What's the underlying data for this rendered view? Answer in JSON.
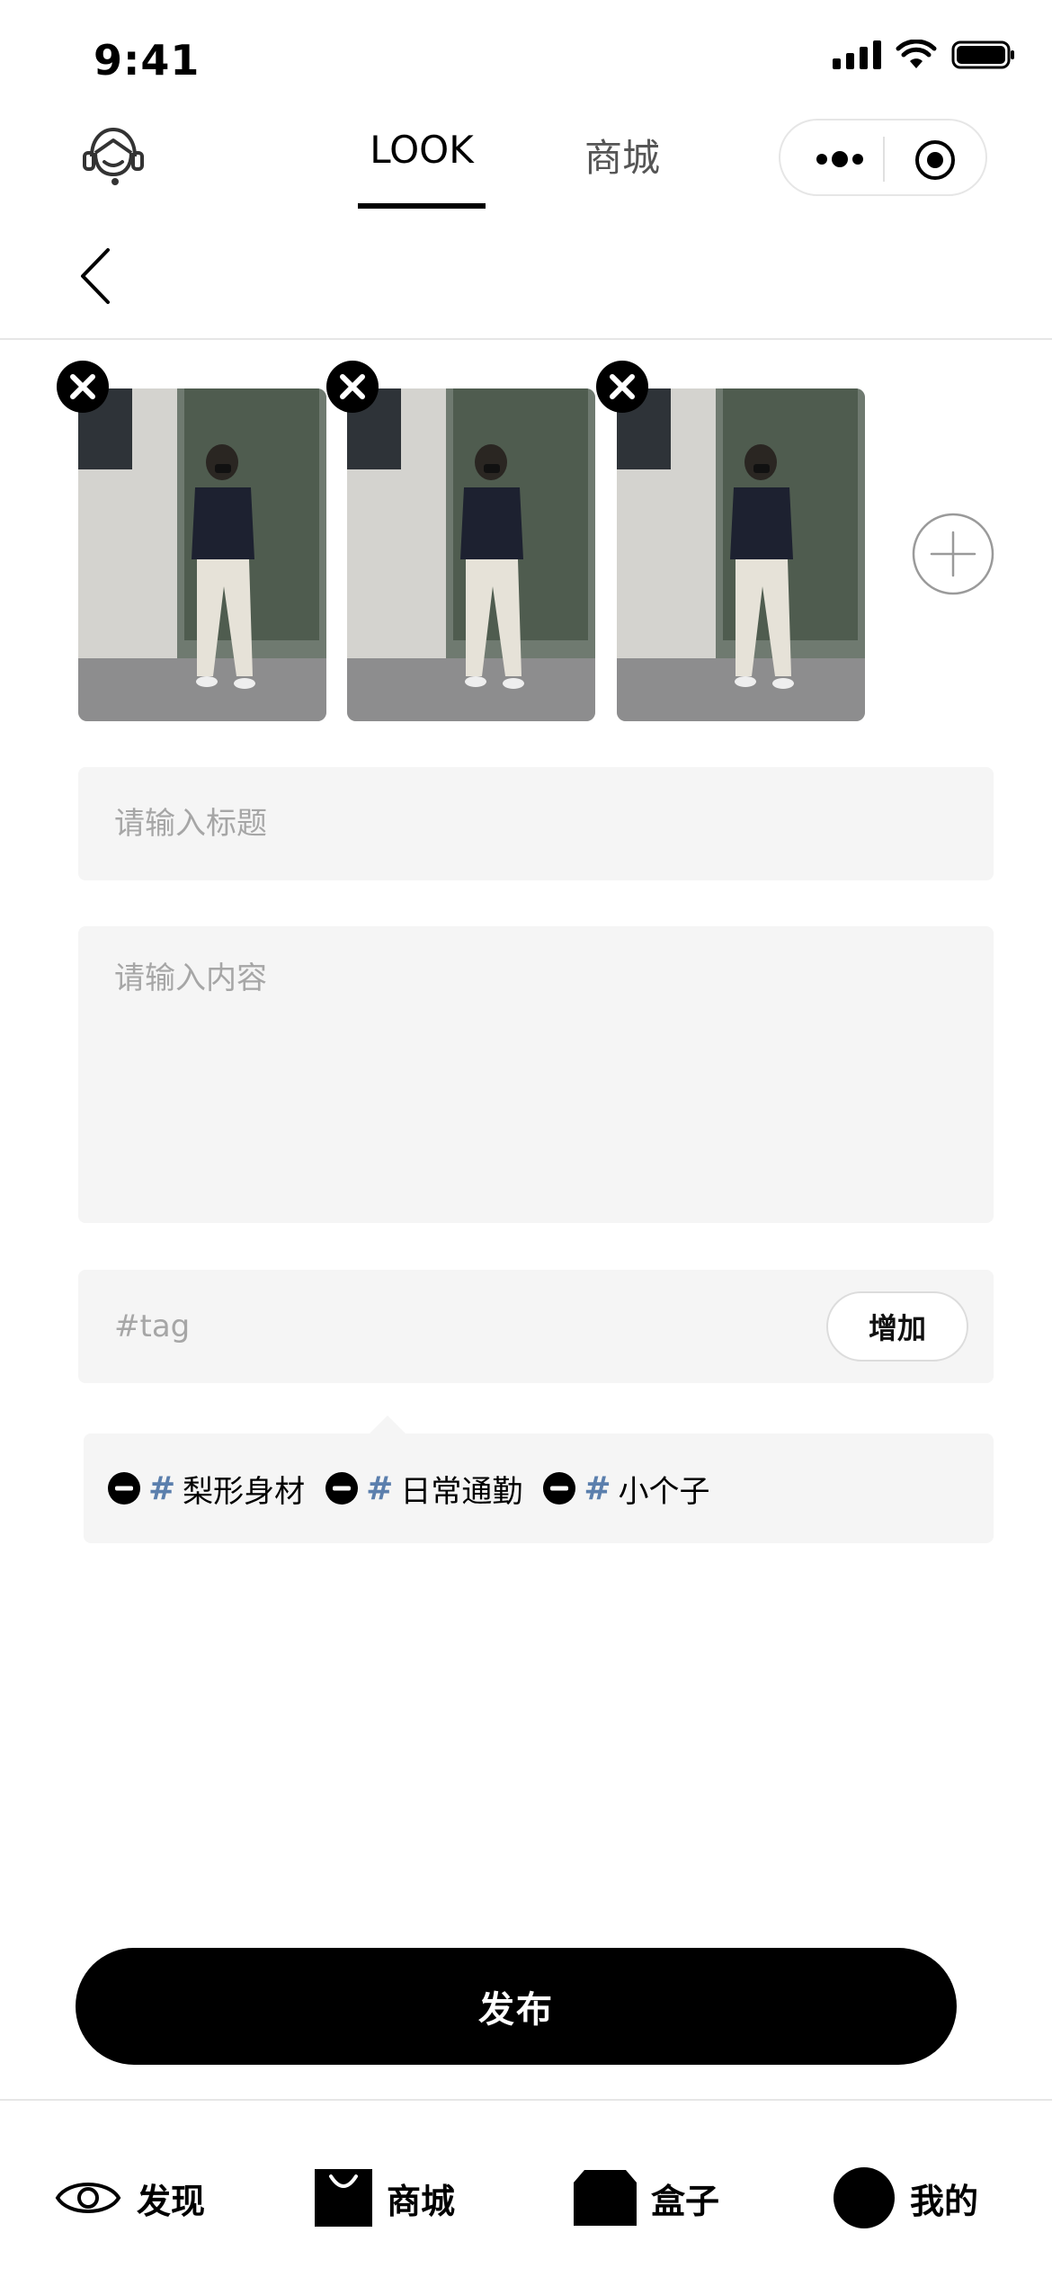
{
  "status_bar": {
    "time": "9:41"
  },
  "header": {
    "tabs": [
      {
        "label": "LOOK",
        "active": true
      },
      {
        "label": "商城",
        "active": false
      }
    ]
  },
  "images": {
    "count": 3,
    "items": [
      "look-photo-1",
      "look-photo-2",
      "look-photo-3"
    ]
  },
  "form": {
    "title_placeholder": "请输入标题",
    "content_placeholder": "请输入内容",
    "tag_placeholder": "#tag",
    "add_tag_label": "增加"
  },
  "tags": [
    {
      "hash": "#",
      "text": "梨形身材"
    },
    {
      "hash": "#",
      "text": "日常通勤"
    },
    {
      "hash": "#",
      "text": "小个子"
    }
  ],
  "publish_label": "发布",
  "tabbar": {
    "items": [
      {
        "label": "发现",
        "icon": "eye-icon"
      },
      {
        "label": "商城",
        "icon": "shopping-bag-icon"
      },
      {
        "label": "盒子",
        "icon": "box-icon"
      },
      {
        "label": "我的",
        "icon": "profile-icon"
      }
    ]
  },
  "colors": {
    "tag_hash": "#5b7fad",
    "input_bg": "#f5f5f5",
    "primary": "#000000"
  }
}
